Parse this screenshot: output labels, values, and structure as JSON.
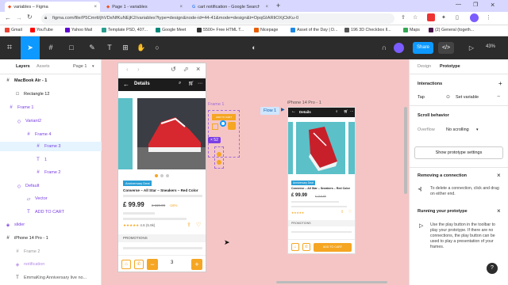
{
  "browser": {
    "tabs": [
      {
        "title": "variables – Figma",
        "active": true
      },
      {
        "title": "Page 1 - variables",
        "active": false
      },
      {
        "title": "cart notification - Google Search",
        "active": false
      }
    ],
    "new_tab": "+",
    "url": "figma.com/file/P5Cmrtt/jhVDsNfKuNEjK2/variables?type=design&node-id=44-41&mode=design&t=OpqGIARliOXjCkKu-0",
    "bookmarks": [
      "Gmail",
      "YouTube",
      "Yahoo Mail",
      "Template PSD, 407...",
      "Google Meet",
      "5500+ Free HTML T...",
      "Nicepage",
      "Asset of the Day | D...",
      "196 3D Checkbox Il...",
      "Maps",
      "(2) General (togeth..."
    ]
  },
  "toolbar": {
    "share_label": "Share",
    "zoom_level": "43%"
  },
  "left_panel": {
    "tabs": [
      "Layers",
      "Assets"
    ],
    "page_label": "Page 1",
    "layers": [
      {
        "name": "MacBook Air - 1",
        "icon": "#"
      },
      {
        "name": "Rectangle 12",
        "icon": "□"
      },
      {
        "name": "Frame 1",
        "icon": "#"
      },
      {
        "name": "Variant2",
        "icon": "◇"
      },
      {
        "name": "Frame 4",
        "icon": "#"
      },
      {
        "name": "Frame 3",
        "icon": "#"
      },
      {
        "name": "1",
        "icon": "T"
      },
      {
        "name": "Frame 2",
        "icon": "#"
      },
      {
        "name": "Default",
        "icon": "◇"
      },
      {
        "name": "Vector",
        "icon": "▱"
      },
      {
        "name": "ADD TO CART",
        "icon": "T"
      },
      {
        "name": "slider",
        "icon": "◈"
      },
      {
        "name": "iPhone 14 Pro - 1",
        "icon": "#"
      },
      {
        "name": "Frame 2",
        "icon": "#"
      },
      {
        "name": "notification",
        "icon": "◈"
      },
      {
        "name": "EmmaKing Anniversary live no...",
        "icon": "T"
      }
    ]
  },
  "canvas": {
    "frame1_label": "Frame 1",
    "flow_label": "Flow 1",
    "iphone_label": "iPhone 14 Pro - 1",
    "size_badge": "× 52",
    "preview_counter": "1",
    "product": {
      "header_title": "Details",
      "badge": "Anniversary Deal",
      "name": "Converse – All Star – Sneakers – Red Color",
      "price": "£ 99.99",
      "old_price": "£ 119.99",
      "discount": "-16%",
      "rating_text": "4.6 (5.9k)",
      "promotions_label": "PROMOTIONS",
      "qty": "3",
      "add_to_cart": "ADD TO CART",
      "minus": "−",
      "plus": "+"
    }
  },
  "right_panel": {
    "tabs": [
      "Design",
      "Prototype"
    ],
    "interactions_label": "Interactions",
    "trigger": "Tap",
    "action": "Set variable",
    "scroll_label": "Scroll behavior",
    "overflow_label": "Overflow",
    "overflow_value": "No scrolling",
    "show_settings": "Show prototype settings",
    "removing_title": "Removing a connection",
    "removing_body": "To delete a connection, click and drag on either end.",
    "running_title": "Running your prototype",
    "running_body": "Use the play button in the toolbar to play your prototype. If there are no connections, the play button can be used to play a presentation of your frames.",
    "help": "?"
  },
  "colors": {
    "accent": "#0d99ff",
    "orange": "#f5a623",
    "canvas": "#f5c5c5",
    "toolbar": "#2c2c2c"
  }
}
